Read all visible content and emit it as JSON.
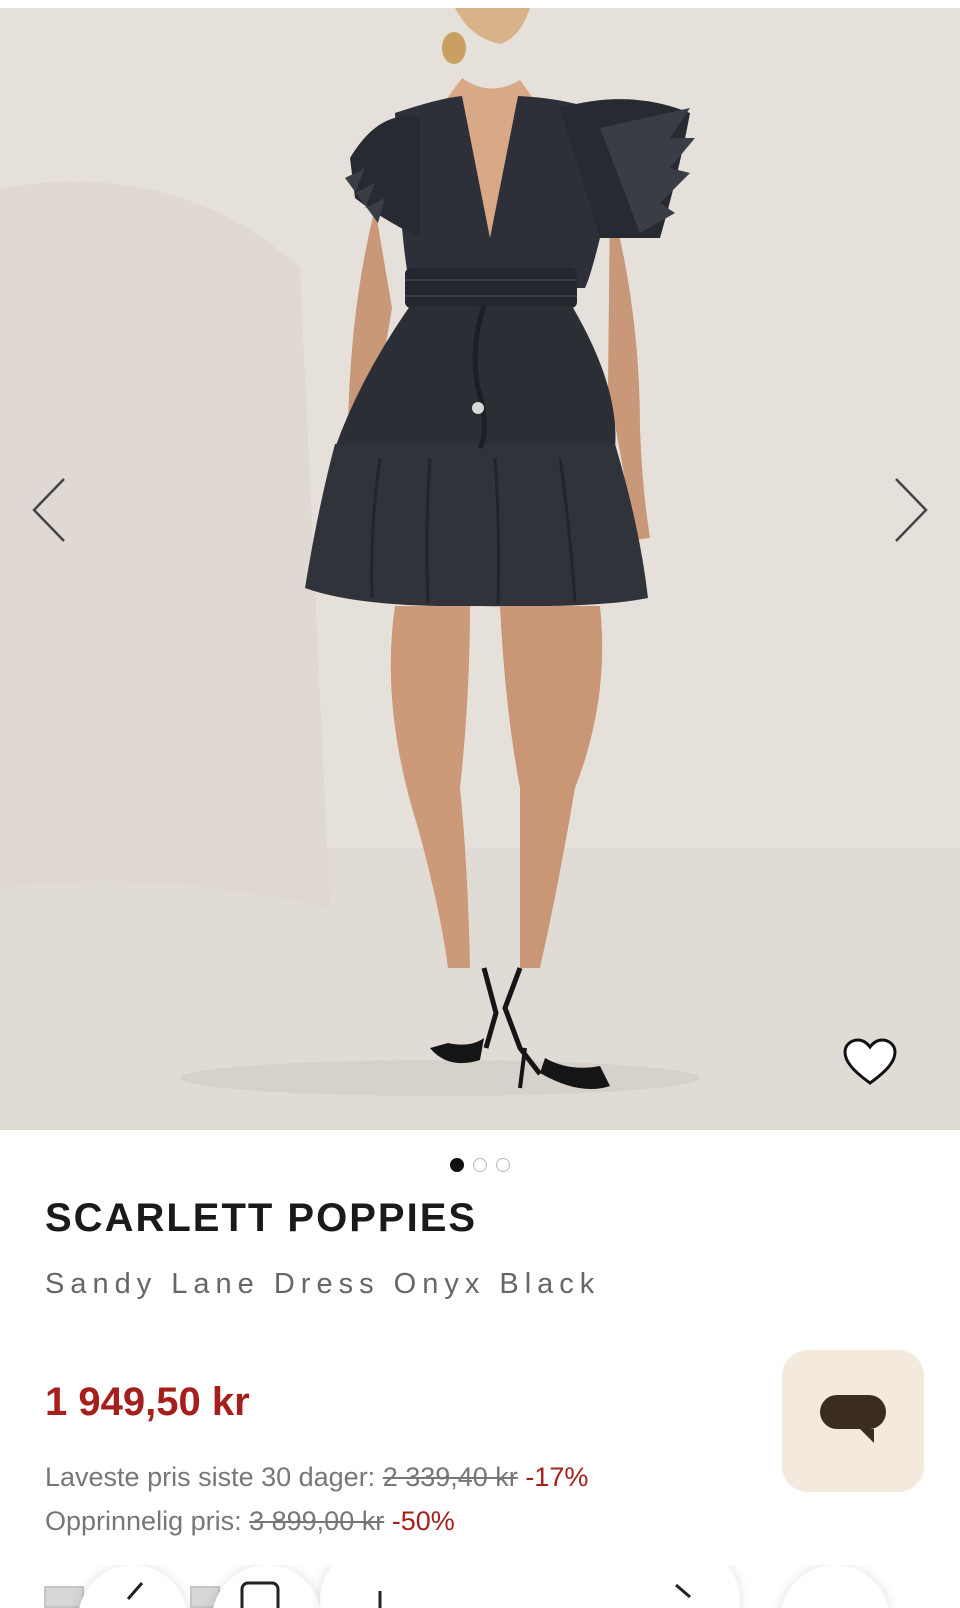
{
  "gallery": {
    "image_alt": "",
    "prev_icon": "chevron-left-icon",
    "next_icon": "chevron-right-icon",
    "wishlist_icon": "heart-icon",
    "slide_count": 3,
    "active_slide": 1
  },
  "product": {
    "brand": "SCARLETT POPPIES",
    "name": "Sandy Lane Dress Onyx Black"
  },
  "pricing": {
    "current_price": "1 949,50 kr",
    "lowest_label": "Laveste pris siste 30 dager:",
    "lowest_price": "2 339,40 kr",
    "lowest_discount": "-17%",
    "original_label": "Opprinnelig pris:",
    "original_price": "3 899,00 kr",
    "original_discount": "-50%"
  },
  "chat": {
    "icon": "chat-icon"
  },
  "colors": {
    "accent_red": "#a5201c",
    "chat_bg": "#f3e9dd",
    "chat_icon": "#3b2c20",
    "image_bg": "#e7e2dd"
  }
}
